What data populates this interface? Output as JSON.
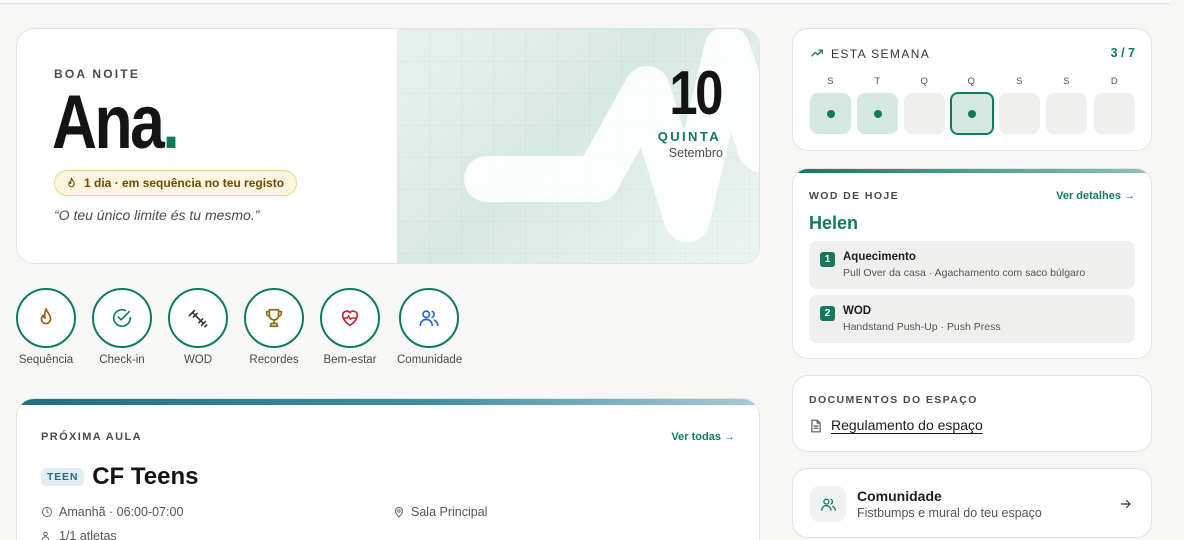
{
  "hero": {
    "greeting": "BOA NOITE",
    "name": "Ana",
    "name_dot": ".",
    "streak": "1 dia · em sequência no teu registo",
    "quote": "“O teu único limite és tu mesmo.”",
    "day_number": "10",
    "day_name": "QUINTA",
    "month": "Setembro"
  },
  "quick_actions": [
    {
      "label": "Sequência",
      "icon": "flame-icon"
    },
    {
      "label": "Check-in",
      "icon": "check-circle-icon"
    },
    {
      "label": "WOD",
      "icon": "dumbbell-icon"
    },
    {
      "label": "Recordes",
      "icon": "trophy-icon"
    },
    {
      "label": "Bem-estar",
      "icon": "heart-pulse-icon"
    },
    {
      "label": "Comunidade",
      "icon": "users-icon"
    }
  ],
  "next_class": {
    "heading": "PRÓXIMA AULA",
    "see_all": "Ver todas →",
    "tag": "TEEN",
    "title": "CF Teens",
    "time": "Amanhã · 06:00-07:00",
    "location": "Sala Principal",
    "athletes": "1/1 atletas"
  },
  "week": {
    "heading": "ESTA SEMANA",
    "count": "3 / 7",
    "days": [
      {
        "label": "S",
        "state": "done"
      },
      {
        "label": "T",
        "state": "done"
      },
      {
        "label": "Q",
        "state": "empty"
      },
      {
        "label": "Q",
        "state": "today"
      },
      {
        "label": "S",
        "state": "empty"
      },
      {
        "label": "S",
        "state": "empty"
      },
      {
        "label": "D",
        "state": "empty"
      }
    ]
  },
  "wod": {
    "heading": "WOD DE HOJE",
    "details": "Ver detalhes →",
    "title": "Helen",
    "items": [
      {
        "num": "1",
        "title": "Aquecimento",
        "desc": "Pull Over da casa · Agachamento com saco búlgaro"
      },
      {
        "num": "2",
        "title": "WOD",
        "desc": "Handstand Push-Up · Push Press"
      }
    ]
  },
  "docs": {
    "heading": "DOCUMENTOS DO ESPAÇO",
    "item": "Regulamento do espaço"
  },
  "community": {
    "title": "Comunidade",
    "subtitle": "Fistbumps e mural do teu espaço"
  },
  "colors": {
    "accent": "#127a5c",
    "streak_bg": "#fdf5dd",
    "class_bar": "#1d6f86"
  }
}
